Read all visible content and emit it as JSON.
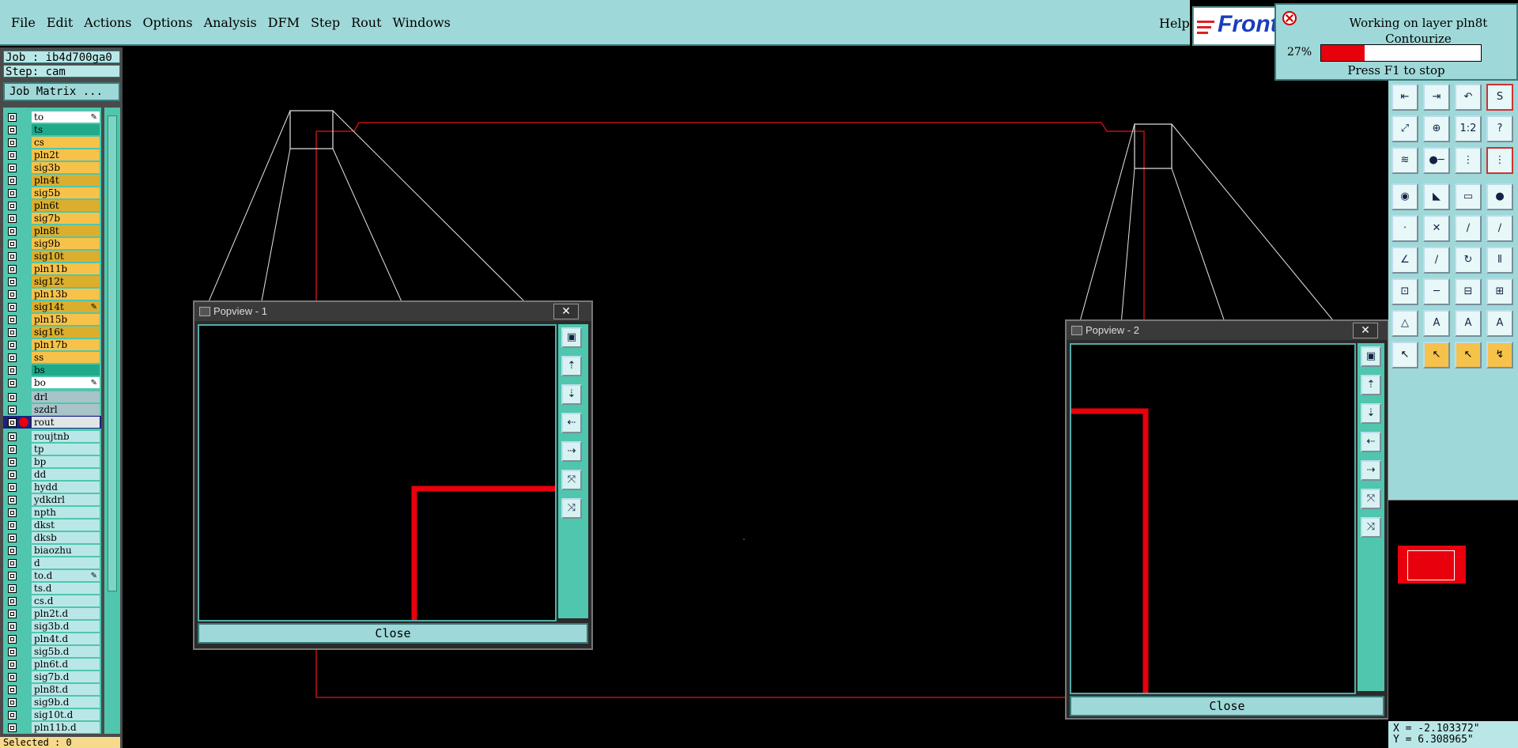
{
  "menu": {
    "items": [
      "File",
      "Edit",
      "Actions",
      "Options",
      "Analysis",
      "DFM",
      "Step",
      "Rout",
      "Windows"
    ],
    "underline": [
      "F",
      "E",
      "A",
      "O",
      "A",
      "D",
      "S",
      "R",
      "W"
    ],
    "help": "Help",
    "logo": "Front"
  },
  "progress": {
    "title": "Working on layer pln8t",
    "subtitle": "Contourize",
    "percent_label": "27%",
    "percent": 0.27,
    "hint": "Press F1 to stop"
  },
  "left": {
    "job": "Job : ib4d700ga0",
    "step": "Step: cam",
    "job_matrix": "Job Matrix ...",
    "selected": "Selected : 0"
  },
  "layers": [
    {
      "name": "to",
      "color": "#ffffff",
      "edit": true
    },
    {
      "name": "ts",
      "color": "#1faa8a"
    },
    {
      "name": "cs",
      "color": "#f6c24a"
    },
    {
      "name": "pln2t",
      "color": "#f6c24a"
    },
    {
      "name": "sig3b",
      "color": "#f6c24a"
    },
    {
      "name": "pln4t",
      "color": "#dcae2e"
    },
    {
      "name": "sig5b",
      "color": "#f6c24a"
    },
    {
      "name": "pln6t",
      "color": "#dcae2e"
    },
    {
      "name": "sig7b",
      "color": "#f6c24a"
    },
    {
      "name": "pln8t",
      "color": "#dcae2e"
    },
    {
      "name": "sig9b",
      "color": "#f6c24a"
    },
    {
      "name": "sig10t",
      "color": "#dcae2e"
    },
    {
      "name": "pln11b",
      "color": "#f6c24a"
    },
    {
      "name": "sig12t",
      "color": "#dcae2e"
    },
    {
      "name": "pln13b",
      "color": "#f6c24a"
    },
    {
      "name": "sig14t",
      "color": "#dcae2e",
      "edit": true
    },
    {
      "name": "pln15b",
      "color": "#f6c24a"
    },
    {
      "name": "sig16t",
      "color": "#dcae2e"
    },
    {
      "name": "pln17b",
      "color": "#f6c24a"
    },
    {
      "name": "ss",
      "color": "#f6c24a"
    },
    {
      "name": "bs",
      "color": "#1faa8a"
    },
    {
      "name": "bo",
      "color": "#ffffff",
      "edit": true
    },
    {
      "name": "",
      "gap": true
    },
    {
      "name": "drl",
      "color": "#a9c4c9"
    },
    {
      "name": "szdrl",
      "color": "#a9c4c9"
    },
    {
      "name": "rout",
      "color": "#dfe6e8",
      "active": true
    },
    {
      "name": "",
      "gap": true
    },
    {
      "name": "roujtnb",
      "color": "#b9e7e7"
    },
    {
      "name": "tp",
      "color": "#b9e7e7"
    },
    {
      "name": "bp",
      "color": "#b9e7e7"
    },
    {
      "name": "dd",
      "color": "#b9e7e7"
    },
    {
      "name": "hydd",
      "color": "#b9e7e7"
    },
    {
      "name": "ydkdrl",
      "color": "#b9e7e7"
    },
    {
      "name": "npth",
      "color": "#b9e7e7"
    },
    {
      "name": "dkst",
      "color": "#b9e7e7"
    },
    {
      "name": "dksb",
      "color": "#b9e7e7"
    },
    {
      "name": "biaozhu",
      "color": "#b9e7e7"
    },
    {
      "name": "d",
      "color": "#b9e7e7"
    },
    {
      "name": "to.d",
      "color": "#b9e7e7",
      "edit": true
    },
    {
      "name": "ts.d",
      "color": "#b9e7e7"
    },
    {
      "name": "cs.d",
      "color": "#b9e7e7"
    },
    {
      "name": "pln2t.d",
      "color": "#b9e7e7"
    },
    {
      "name": "sig3b.d",
      "color": "#b9e7e7"
    },
    {
      "name": "pln4t.d",
      "color": "#b9e7e7"
    },
    {
      "name": "sig5b.d",
      "color": "#b9e7e7"
    },
    {
      "name": "pln6t.d",
      "color": "#b9e7e7"
    },
    {
      "name": "sig7b.d",
      "color": "#b9e7e7"
    },
    {
      "name": "pln8t.d",
      "color": "#b9e7e7"
    },
    {
      "name": "sig9b.d",
      "color": "#b9e7e7"
    },
    {
      "name": "sig10t.d",
      "color": "#b9e7e7"
    },
    {
      "name": "pln11b.d",
      "color": "#b9e7e7"
    }
  ],
  "popview1": {
    "title": "Popview - 1",
    "close": "Close"
  },
  "popview2": {
    "title": "Popview - 2",
    "close": "Close"
  },
  "coords": {
    "x": "X = -2.103372\"",
    "y": "Y = 6.308965\""
  },
  "toolbar_icons": [
    "zoom-prev-icon",
    "zoom-next-icon",
    "undo-view-icon",
    "redraw-icon",
    "zoom-fit-icon",
    "zoom-home-icon",
    "scale-1to2-icon",
    "help-icon",
    "measure-icon",
    "pad-icon",
    "layer-stack-icon",
    "layer-stack-red-icon",
    "drill-icon",
    "snap-icon",
    "ruler-icon",
    "circle-icon",
    "node-icon",
    "cross-icon",
    "line-node-icon",
    "arc-node-icon",
    "angle-icon",
    "diagonal-icon",
    "rotate-icon",
    "split-icon",
    "move-icon",
    "hline-icon",
    "center-icon",
    "group-icon",
    "triangle-icon",
    "triangle-a-icon",
    "triangle-b-icon",
    "triangle-c-icon",
    "pointer-icon",
    "pointer-sel-icon",
    "pointer-snap-icon",
    "route-icon"
  ],
  "toolbar_glyphs": [
    "⇤",
    "⇥",
    "↶",
    "S",
    "⤢",
    "⊕",
    "1:2",
    "?",
    "≋",
    "●─",
    "⋮",
    "⋮",
    "◉",
    "◣",
    "▭",
    "●",
    "⋅",
    "✕",
    "∕",
    "∕",
    "∠",
    "∕",
    "↻",
    "⫴",
    "⊡",
    "─",
    "⊟",
    "⊞",
    "△",
    "A",
    "A",
    "A",
    "↖",
    "↖",
    "↖",
    "↯"
  ],
  "pop_icons": [
    "window-icon",
    "move-up-icon",
    "move-down-icon",
    "move-left-icon",
    "move-right-icon",
    "zoom-in-icon",
    "zoom-out-icon"
  ],
  "pop_glyphs": [
    "▣",
    "⇡",
    "⇣",
    "⇠",
    "⇢",
    "⤧",
    "⤨"
  ],
  "colors": {
    "menu": "#9fd8d8",
    "panel": "#4fc6ad",
    "trace": "#e8000c",
    "outline": "#c01010"
  }
}
